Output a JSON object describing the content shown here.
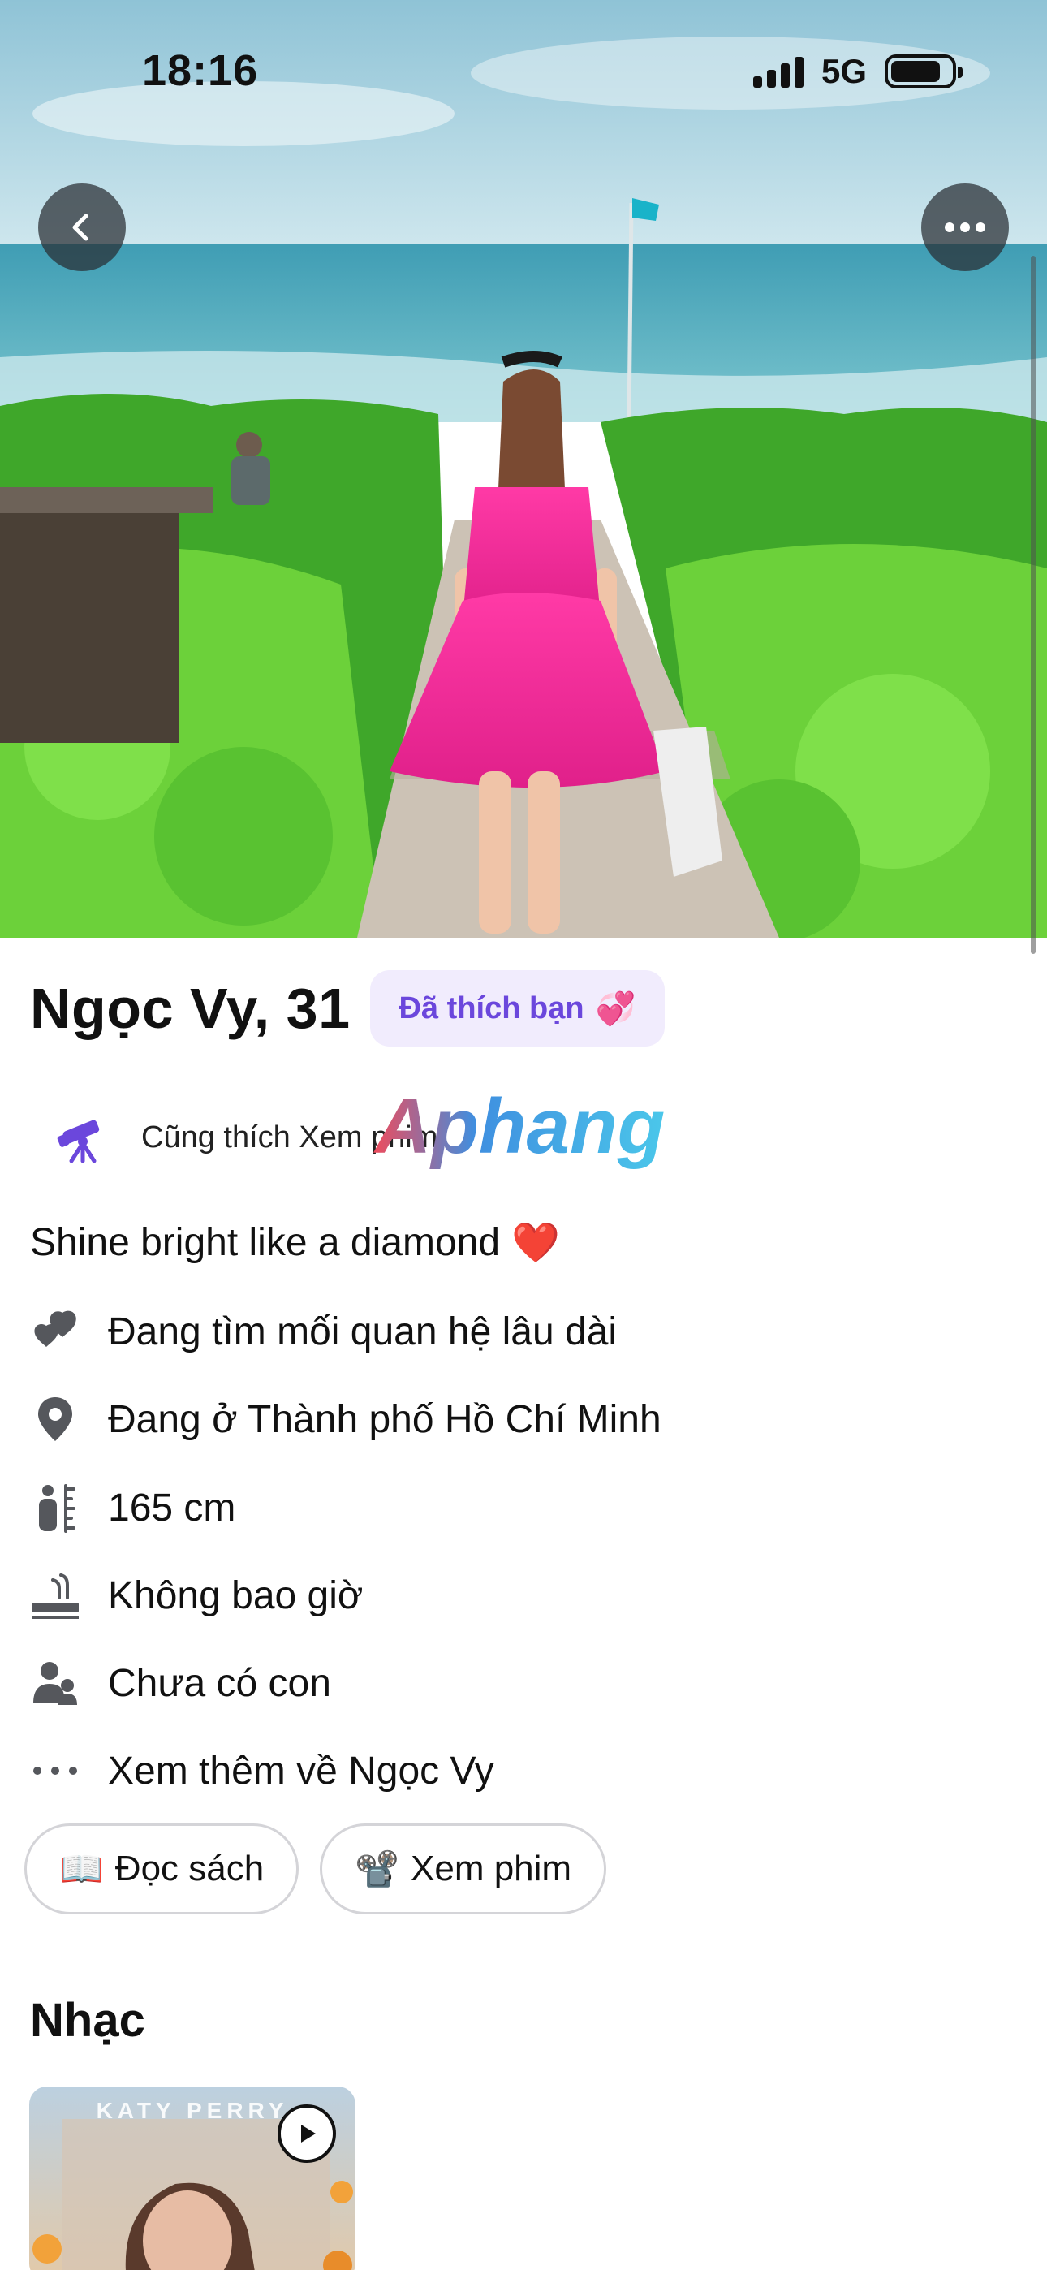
{
  "status_bar": {
    "time": "18:16",
    "network": "5G"
  },
  "nav": {
    "back_icon": "chevron-left-icon",
    "more_icon": "ellipsis-icon"
  },
  "profile": {
    "name_age": "Ngọc Vy, 31",
    "liked_badge": "Đã thích bạn",
    "liked_badge_emoji": "💞",
    "common_interest": "Cũng thích Xem phim",
    "watermark": "Aphang",
    "bio": "Shine bright like a diamond",
    "bio_emoji": "❤️"
  },
  "details": [
    {
      "icon": "hearts-icon",
      "label": "Đang tìm mối quan hệ lâu dài"
    },
    {
      "icon": "location-pin-icon",
      "label": "Đang ở Thành phố Hồ Chí Minh"
    },
    {
      "icon": "height-icon",
      "label": "165 cm"
    },
    {
      "icon": "smoking-icon",
      "label": "Không bao giờ"
    },
    {
      "icon": "children-icon",
      "label": "Chưa có con"
    },
    {
      "icon": "ellipsis-icon",
      "label": "Xem thêm về Ngọc Vy"
    }
  ],
  "interests": [
    {
      "emoji": "📖",
      "label": "Đọc sách"
    },
    {
      "emoji": "📽️",
      "label": "Xem phim"
    }
  ],
  "music": {
    "section_title": "Nhạc",
    "album_artist": "KATY PERRY"
  },
  "colors": {
    "accent_purple": "#6b47dc",
    "badge_bg": "#f1ecfd",
    "chip_border": "#d4d4d8",
    "icon_gray": "#55575c"
  }
}
